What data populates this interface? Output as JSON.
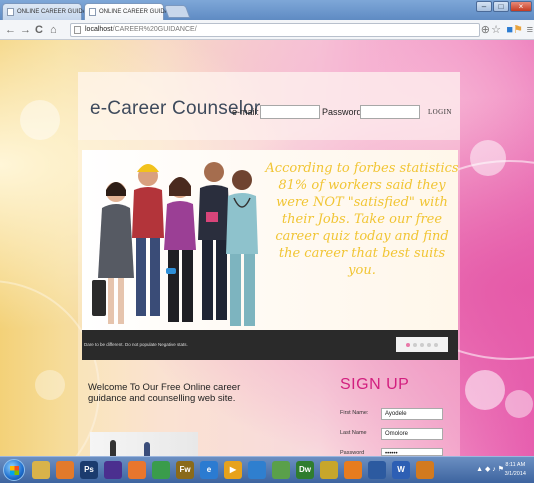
{
  "browser": {
    "tabs": [
      {
        "title": "ONLINE CAREER GUIDAN",
        "close": "×",
        "active": false
      },
      {
        "title": "ONLINE CAREER GUIDAN",
        "close": "×",
        "active": true
      }
    ],
    "nav": {
      "back": "←",
      "forward": "→",
      "reload": "C",
      "home": "⌂"
    },
    "address": {
      "host": "localhost",
      "path": "/CAREER%20GUIDANCE/"
    },
    "window_buttons": {
      "minimize": "–",
      "maximize": "□",
      "close": "×"
    },
    "toolbar_icons": [
      "zoom-icon",
      "star-icon",
      "extension-icon",
      "flag-icon",
      "menu-icon"
    ]
  },
  "site": {
    "logo": "e-Career Counselor",
    "login": {
      "email_label": "e-mail:",
      "password_label": "Password:",
      "button": "LOGIN"
    },
    "banner": {
      "quote": "According to forbes statistics 81% of workers said they were NOT \"satisfied\" with their Jobs. Take our free career quiz today and find the career that best suits you.",
      "caption": "Dare to be different. Do not populate Negative stats."
    },
    "welcome": "Welcome To Our Free Online career guidance and counselling web site.",
    "signup": {
      "title": "SIGN UP",
      "fields": [
        {
          "label": "First Name:",
          "value": "Ayodele"
        },
        {
          "label": "Last Name",
          "value": "Omolore"
        },
        {
          "label": "Password",
          "value": "••••••"
        }
      ]
    }
  },
  "taskbar": {
    "clock_time": "8:11 AM",
    "clock_date": "3/1/2014",
    "apps": [
      {
        "name": "explorer",
        "label": "",
        "color": "#d9b34a"
      },
      {
        "name": "settings",
        "label": "",
        "color": "#e27a2b"
      },
      {
        "name": "photoshop",
        "label": "Ps",
        "color": "#1b3b6e"
      },
      {
        "name": "vs",
        "label": "",
        "color": "#4b2f8f"
      },
      {
        "name": "firefox",
        "label": "",
        "color": "#e8762d"
      },
      {
        "name": "chrome",
        "label": "",
        "color": "#3a9c4b"
      },
      {
        "name": "fireworks",
        "label": "Fw",
        "color": "#8a6a1a"
      },
      {
        "name": "ie",
        "label": "e",
        "color": "#2b7bd1"
      },
      {
        "name": "media",
        "label": "▶",
        "color": "#e7a21c"
      },
      {
        "name": "app-blue",
        "label": "",
        "color": "#2f7fcf"
      },
      {
        "name": "app-green",
        "label": "",
        "color": "#5aa04a"
      },
      {
        "name": "dreamweaver",
        "label": "Dw",
        "color": "#2f7d2f"
      },
      {
        "name": "app-yellow",
        "label": "",
        "color": "#c7a62b"
      },
      {
        "name": "vlc",
        "label": "",
        "color": "#e77c1e"
      },
      {
        "name": "app-dark",
        "label": "",
        "color": "#2c5aa0"
      },
      {
        "name": "word",
        "label": "W",
        "color": "#2d5fb4"
      },
      {
        "name": "app-orange",
        "label": "",
        "color": "#d27a1f"
      }
    ]
  }
}
